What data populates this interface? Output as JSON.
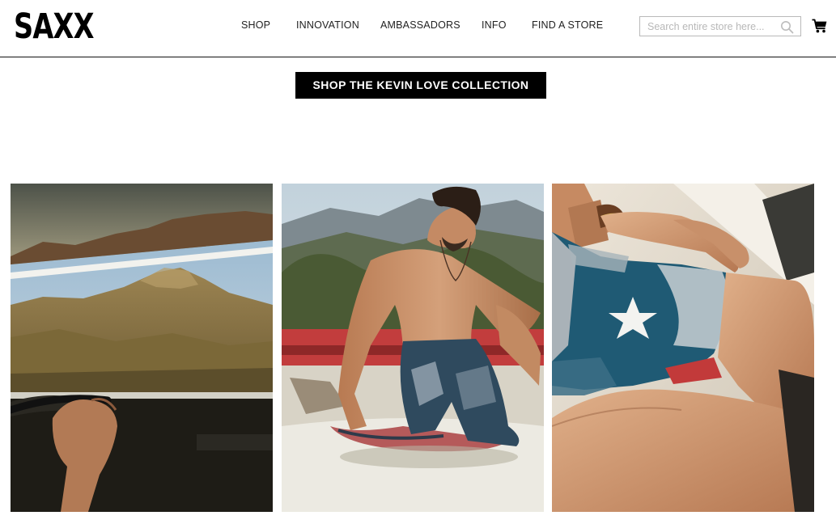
{
  "header": {
    "logo": "SAXX",
    "nav": [
      "SHOP",
      "INNOVATION",
      "AMBASSADORS",
      "INFO",
      "FIND A STORE"
    ],
    "search_placeholder": "Search entire store here...",
    "icons": {
      "search": "magnifier-icon",
      "cart": "cart-icon"
    }
  },
  "promo": {
    "cta_label": "SHOP THE KEVIN LOVE COLLECTION"
  },
  "gallery": {
    "tiles": [
      {
        "name": "desert-drive-photo"
      },
      {
        "name": "model-on-car-photo"
      },
      {
        "name": "flag-boxer-closeup-photo"
      }
    ]
  },
  "colors": {
    "brand_black": "#000000",
    "border": "#b9b9b9"
  }
}
